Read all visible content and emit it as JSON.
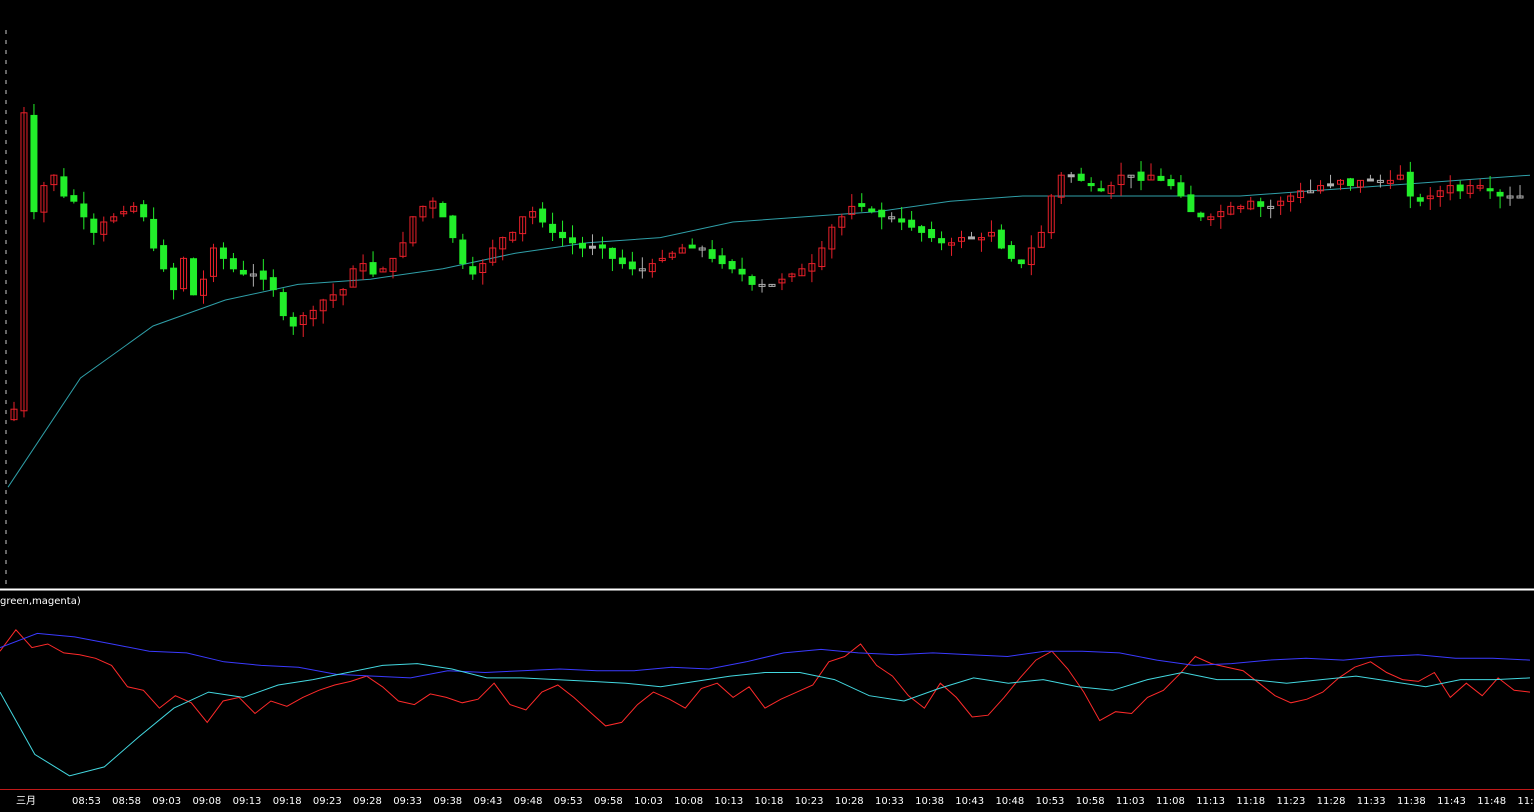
{
  "indicator": {
    "title": "green,magenta)"
  },
  "colors": {
    "background": "#000000",
    "up": "#e8202a",
    "down": "#22ee2a",
    "doji": "#b0b0b0",
    "ma": "#2f9fa8",
    "separator": "#ffffff",
    "axis_line": "#c01818",
    "red_line": "#ff2a2a",
    "blue_line": "#3a3aff",
    "cyan_line": "#43d8e0",
    "magenta_line": "#ff44ff",
    "green_line": "#22ee22"
  },
  "chart_data": [
    {
      "type": "candlestick",
      "ylim": [
        0,
        1
      ],
      "x_ticks": [
        "三月",
        "08:53",
        "08:58",
        "09:03",
        "09:08",
        "09:13",
        "09:18",
        "09:23",
        "09:28",
        "09:33",
        "09:38",
        "09:43",
        "09:48",
        "09:53",
        "09:58",
        "10:03",
        "10:08",
        "10:13",
        "10:18",
        "10:23",
        "10:28",
        "10:33",
        "10:38",
        "10:43",
        "10:48",
        "10:53",
        "10:58",
        "11:03",
        "11:08",
        "11:13",
        "11:18",
        "11:23",
        "11:28",
        "11:33",
        "11:38",
        "11:43",
        "11:48",
        "11:5"
      ],
      "closes": [
        0.29,
        0.86,
        0.67,
        0.72,
        0.74,
        0.7,
        0.69,
        0.66,
        0.63,
        0.65,
        0.66,
        0.67,
        0.68,
        0.66,
        0.6,
        0.56,
        0.52,
        0.58,
        0.51,
        0.54,
        0.6,
        0.58,
        0.56,
        0.55,
        0.55,
        0.54,
        0.52,
        0.47,
        0.45,
        0.47,
        0.48,
        0.5,
        0.51,
        0.52,
        0.56,
        0.57,
        0.55,
        0.56,
        0.58,
        0.61,
        0.66,
        0.68,
        0.69,
        0.66,
        0.62,
        0.57,
        0.55,
        0.57,
        0.6,
        0.62,
        0.63,
        0.66,
        0.67,
        0.65,
        0.63,
        0.62,
        0.61,
        0.6,
        0.6,
        0.6,
        0.58,
        0.57,
        0.56,
        0.56,
        0.57,
        0.58,
        0.59,
        0.6,
        0.6,
        0.6,
        0.58,
        0.57,
        0.56,
        0.55,
        0.53,
        0.53,
        0.53,
        0.54,
        0.55,
        0.56,
        0.57,
        0.6,
        0.64,
        0.66,
        0.68,
        0.68,
        0.67,
        0.66,
        0.66,
        0.65,
        0.64,
        0.63,
        0.62,
        0.61,
        0.61,
        0.62,
        0.62,
        0.62,
        0.63,
        0.6,
        0.58,
        0.57,
        0.6,
        0.63,
        0.7,
        0.74,
        0.74,
        0.73,
        0.72,
        0.71,
        0.72,
        0.74,
        0.74,
        0.73,
        0.74,
        0.73,
        0.72,
        0.7,
        0.67,
        0.66,
        0.66,
        0.67,
        0.68,
        0.68,
        0.69,
        0.68,
        0.68,
        0.69,
        0.7,
        0.71,
        0.71,
        0.72,
        0.72,
        0.73,
        0.72,
        0.73,
        0.73,
        0.73,
        0.73,
        0.74,
        0.7,
        0.69,
        0.7,
        0.71,
        0.72,
        0.71,
        0.72,
        0.72,
        0.71,
        0.7,
        0.7,
        0.7
      ],
      "series": [
        {
          "name": "",
          "values": [
            0.14,
            0.35,
            0.45,
            0.5,
            0.53,
            0.54,
            0.56,
            0.59,
            0.61,
            0.62,
            0.65,
            0.66,
            0.67,
            0.69,
            0.7,
            0.7,
            0.7,
            0.7,
            0.71,
            0.72,
            0.73,
            0.74
          ]
        }
      ]
    },
    {
      "type": "line",
      "series": [
        {
          "name": "",
          "values": [
            0.78,
            0.9,
            0.8,
            0.82,
            0.77,
            0.76,
            0.74,
            0.7,
            0.58,
            0.56,
            0.46,
            0.53,
            0.49,
            0.38,
            0.5,
            0.52,
            0.43,
            0.5,
            0.47,
            0.52,
            0.56,
            0.59,
            0.61,
            0.64,
            0.58,
            0.5,
            0.48,
            0.54,
            0.52,
            0.49,
            0.51,
            0.6,
            0.48,
            0.45,
            0.55,
            0.59,
            0.52,
            0.44,
            0.36,
            0.38,
            0.48,
            0.55,
            0.51,
            0.46,
            0.57,
            0.6,
            0.52,
            0.58,
            0.46,
            0.51,
            0.55,
            0.59,
            0.72,
            0.75,
            0.82,
            0.7,
            0.64,
            0.53,
            0.46,
            0.6,
            0.52,
            0.41,
            0.42,
            0.52,
            0.63,
            0.73,
            0.78,
            0.68,
            0.55,
            0.39,
            0.44,
            0.43,
            0.52,
            0.56,
            0.65,
            0.75,
            0.71,
            0.69,
            0.67,
            0.6,
            0.53,
            0.49,
            0.51,
            0.55,
            0.63,
            0.69,
            0.72,
            0.66,
            0.62,
            0.61,
            0.66,
            0.52,
            0.6,
            0.53,
            0.63,
            0.56,
            0.55
          ]
        },
        {
          "name": "",
          "values": [
            0.8,
            0.88,
            0.86,
            0.82,
            0.78,
            0.77,
            0.72,
            0.7,
            0.69,
            0.65,
            0.64,
            0.63,
            0.67,
            0.66,
            0.67,
            0.68,
            0.67,
            0.67,
            0.69,
            0.68,
            0.72,
            0.77,
            0.79,
            0.77,
            0.76,
            0.77,
            0.76,
            0.75,
            0.78,
            0.78,
            0.77,
            0.73,
            0.7,
            0.71,
            0.73,
            0.74,
            0.73,
            0.75,
            0.76,
            0.74,
            0.74,
            0.73
          ]
        },
        {
          "name": "",
          "values": [
            0.55,
            0.2,
            0.08,
            0.13,
            0.3,
            0.46,
            0.55,
            0.52,
            0.59,
            0.62,
            0.66,
            0.7,
            0.71,
            0.68,
            0.63,
            0.63,
            0.62,
            0.61,
            0.6,
            0.58,
            0.61,
            0.64,
            0.66,
            0.66,
            0.62,
            0.53,
            0.5,
            0.57,
            0.63,
            0.6,
            0.62,
            0.58,
            0.56,
            0.62,
            0.66,
            0.62,
            0.62,
            0.6,
            0.62,
            0.64,
            0.61,
            0.58,
            0.62,
            0.62,
            0.63
          ]
        }
      ]
    }
  ]
}
